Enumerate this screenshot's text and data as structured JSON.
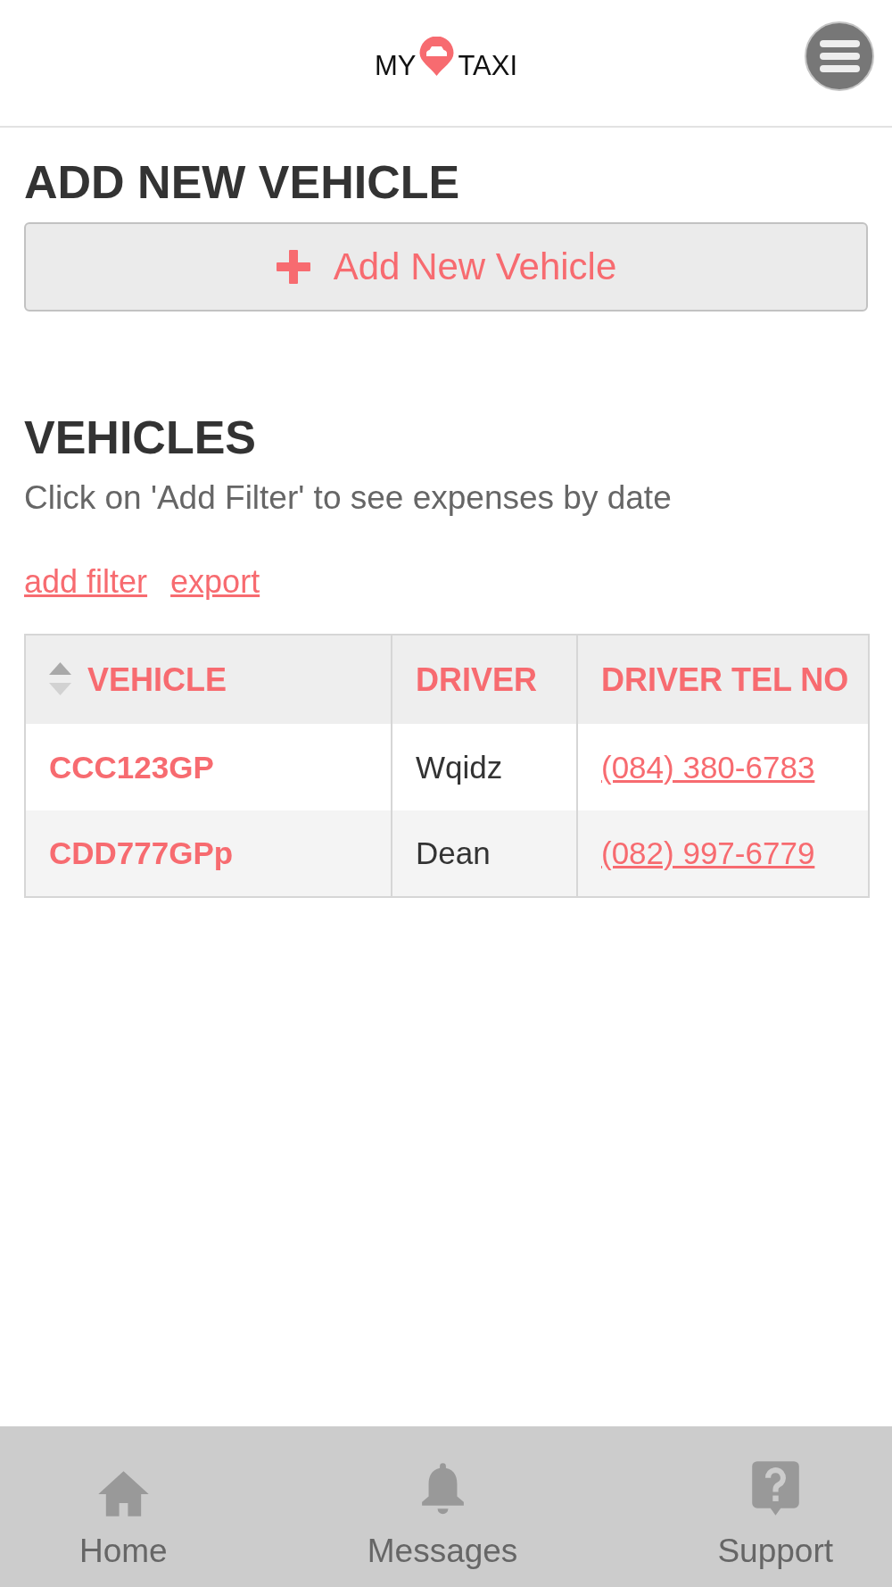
{
  "header": {
    "logo": {
      "left_text": "MY",
      "right_text": "TAXI"
    }
  },
  "add_vehicle": {
    "title": "ADD NEW VEHICLE",
    "button": "Add New Vehicle"
  },
  "vehicles": {
    "title": "VEHICLES",
    "description": "Click on 'Add Filter' to see expenses by date",
    "links": [
      "add filter",
      "export"
    ]
  },
  "table": {
    "columns": [
      {
        "label": "VEHICLE",
        "kind": "code",
        "sortable": true
      },
      {
        "label": "DRIVER",
        "kind": "text",
        "sortable": false
      },
      {
        "label": "DRIVER TEL NO",
        "kind": "link",
        "sortable": false
      }
    ],
    "rows": [
      [
        "CCC123GP",
        "Wqidz",
        "(084) 380-6783"
      ],
      [
        "CDD777GPp",
        "Dean",
        "(082) 997-6779"
      ]
    ]
  },
  "bottom_nav": [
    {
      "label": "Home",
      "kind": "home"
    },
    {
      "label": "Messages",
      "kind": "bell"
    },
    {
      "label": "Support",
      "kind": "help"
    }
  ]
}
